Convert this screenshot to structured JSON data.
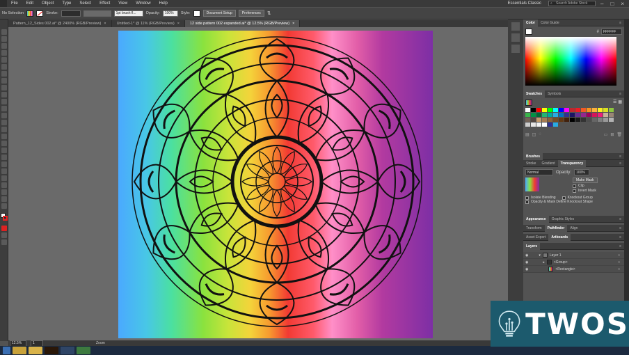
{
  "menubar": {
    "items": [
      "File",
      "Edit",
      "Object",
      "Type",
      "Select",
      "Effect",
      "View",
      "Window",
      "Help"
    ],
    "workspace": "Essentials Classic",
    "search_placeholder": "Search Adobe Stock"
  },
  "control_bar": {
    "selection_label": "No Selection",
    "stroke_label": "Stroke:",
    "brush": "1pt brush fl...",
    "opacity_label": "Opacity:",
    "opacity_value": "100%",
    "style_label": "Style:",
    "document_setup": "Document Setup",
    "preferences": "Preferences"
  },
  "tabs": [
    {
      "label": "Pattern_12_Sides 002.ai* @ 2400% (RGB/Preview)"
    },
    {
      "label": "Untitled-1* @ 11% (RGB/Preview)"
    },
    {
      "label": "12 side pattern 002 expanded.ai* @ 12.5% (RGB/Preview)"
    }
  ],
  "status": {
    "zoom": "12.5%",
    "artboard": "1",
    "tool": "Zoom"
  },
  "color_panel": {
    "tabs": [
      "Color",
      "Color Guide"
    ],
    "hex": "FFFFFF"
  },
  "swatches_panel": {
    "tabs": [
      "Swatches",
      "Symbols"
    ],
    "colors": [
      "#ffffff",
      "#000000",
      "#ff0000",
      "#ffff00",
      "#00ff00",
      "#00ffff",
      "#0000ff",
      "#ff00ff",
      "#c1272d",
      "#ed1c24",
      "#f15a24",
      "#f7931e",
      "#fbb03b",
      "#fcee21",
      "#d9e021",
      "#8cc63f",
      "#39b54a",
      "#009245",
      "#006837",
      "#22b573",
      "#00a99d",
      "#29abe2",
      "#0071bc",
      "#2e3192",
      "#1b1464",
      "#662d91",
      "#93278f",
      "#9e005d",
      "#d4145a",
      "#ed1e79",
      "#c7b299",
      "#998675",
      "#736357",
      "#534741",
      "#c69c6d",
      "#a67c52",
      "#8c6239",
      "#754c24",
      "#603813",
      "#42210b",
      "#000000",
      "#1a1a1a",
      "#333333",
      "#4d4d4d",
      "#666666",
      "#808080",
      "#999999",
      "#b3b3b3",
      "#cccccc",
      "#e6e6e6",
      "#f2f2f2",
      "#ffffff",
      "#2e3192",
      "#29abe2"
    ]
  },
  "brushes_panel": {
    "title": "Brushes"
  },
  "transparency_panel": {
    "tabs": [
      "Stroke",
      "Gradient",
      "Transparency"
    ],
    "blend": "Normal",
    "opacity_label": "Opacity:",
    "opacity": "100%",
    "make_mask": "Make Mask",
    "clip": "Clip",
    "invert_mask": "Invert Mask",
    "isolate": "Isolate Blending",
    "knockout": "Knockout Group",
    "opacity_mask": "Opacity & Mask Define Knockout Shape"
  },
  "appearance_panel": {
    "tabs": [
      "Appearance",
      "Graphic Styles"
    ]
  },
  "transform_panel": {
    "tabs": [
      "Transform",
      "Pathfinder",
      "Align"
    ]
  },
  "asset_panel": {
    "tabs": [
      "Asset Export",
      "Artboards"
    ]
  },
  "layers_panel": {
    "title": "Layers",
    "rows": [
      {
        "name": "Layer 1"
      },
      {
        "name": "<Group>"
      },
      {
        "name": "<Rectangle>"
      }
    ]
  },
  "watermark": {
    "word": "TWOS"
  }
}
